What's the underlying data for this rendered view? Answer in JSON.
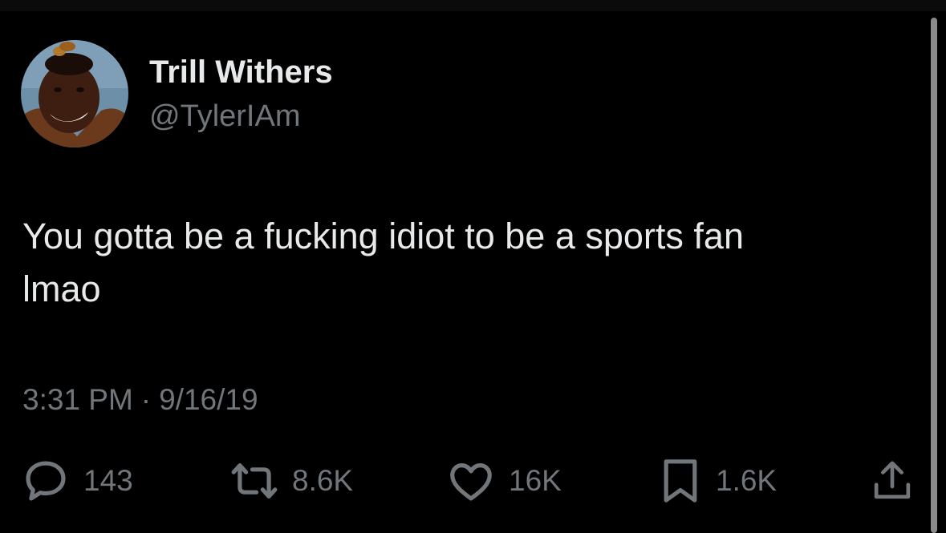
{
  "tweet": {
    "display_name": "Trill Withers",
    "handle": "@TylerIAm",
    "text_line1": "You gotta be a fucking idiot to be a sports fan",
    "text_line2": "lmao",
    "time": "3:31 PM",
    "separator": "·",
    "date": "9/16/19"
  },
  "actions": {
    "replies": {
      "icon": "reply-icon",
      "count": "143"
    },
    "retweets": {
      "icon": "retweet-icon",
      "count": "8.6K"
    },
    "likes": {
      "icon": "heart-icon",
      "count": "16K"
    },
    "bookmarks": {
      "icon": "bookmark-icon",
      "count": "1.6K"
    },
    "share": {
      "icon": "share-icon"
    }
  },
  "colors": {
    "background": "#000000",
    "primary_text": "#e7e9ea",
    "secondary_text": "#71767b"
  }
}
